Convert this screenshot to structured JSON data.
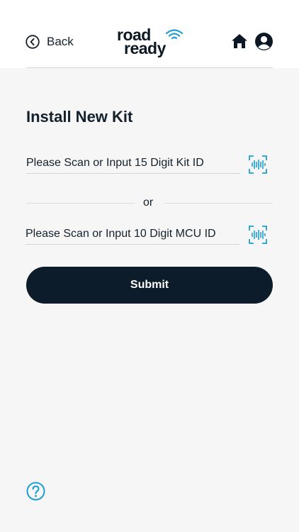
{
  "header": {
    "back_label": "Back",
    "logo": {
      "line1": "road",
      "line2": "ready"
    },
    "icons": {
      "back": "chevron-left-circle-icon",
      "home": "home-icon",
      "profile": "user-circle-icon"
    }
  },
  "main": {
    "title": "Install New Kit",
    "kit_field": {
      "placeholder": "Please Scan or Input 15 Digit Kit ID",
      "value": ""
    },
    "divider_text": "or",
    "mcu_field": {
      "placeholder": "Please Scan or Input 10 Digit MCU ID",
      "value": ""
    },
    "submit_label": "Submit",
    "scan_icon": "barcode-scan-icon"
  },
  "footer": {
    "help_icon": "question-circle-icon"
  },
  "colors": {
    "primary_dark": "#0c1c2a",
    "accent": "#1e9fd1",
    "background": "#f6f6f6"
  }
}
